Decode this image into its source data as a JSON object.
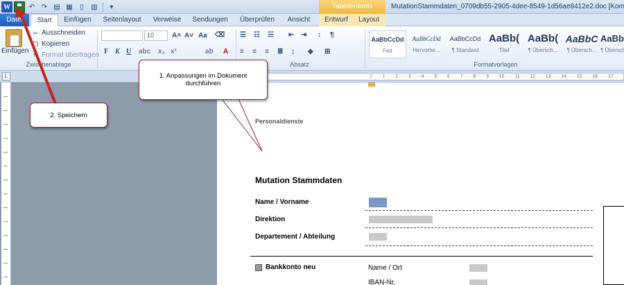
{
  "window": {
    "app_logo": "W",
    "document_title": "MutationStammdaten_0709db55-2905-4dee-8549-1d56ae8412e2.doc [Kompatibilitätsmodus]",
    "context_group": "Tabellentools"
  },
  "tabs": [
    "Datei",
    "Start",
    "Einfügen",
    "Seitenlayout",
    "Verweise",
    "Sendungen",
    "Überprüfen",
    "Ansicht",
    "Entwurf",
    "Layout"
  ],
  "ribbon": {
    "clipboard": {
      "paste": "Einfügen",
      "cut": "Ausschneiden",
      "copy": "Kopieren",
      "format_painter": "Format übertragen",
      "label": "Zwischenablage"
    },
    "font": {
      "size": "10",
      "grow": "A˄",
      "shrink": "A˅",
      "case": "Aa",
      "bold": "F",
      "italic": "K",
      "underline": "U"
    },
    "paragraph_label": "Absatz",
    "styles_label": "Formatvorlagen",
    "styles": [
      {
        "sample": "AaBbCcDd",
        "name": "Fett"
      },
      {
        "sample": "AaBbCcDd",
        "name": "Hervorhe..."
      },
      {
        "sample": "AaBbCcDd",
        "name": "¶ Standard"
      },
      {
        "sample": "AaBb(",
        "name": "Titel"
      },
      {
        "sample": "AaBb(",
        "name": "¶ Übersch..."
      },
      {
        "sample": "AaBbC",
        "name": "¶ Übersch..."
      },
      {
        "sample": "AaBb",
        "name": "¶ Übersch..."
      }
    ]
  },
  "ruler": {
    "corner": "L",
    "marks": "1 · · · 1 · · · 2 · · · 3 · · · 4 · · · 5 · · · 6 · · · 7 · · · 8 · · · 9 · · · 10 · · · 11 · · · 12 · · · 13 · · · 14 · · · 15 · · · 16 · · · 17 · · · 18"
  },
  "document": {
    "header": "Personaldienste",
    "title": "Mutation Stammdaten",
    "fields": [
      "Name / Vorname",
      "Direktion",
      "Departement  / Abteilung"
    ],
    "bank_section": "Bankkonto neu",
    "bank_fields": [
      "Name / Ort",
      "IBAN-Nr."
    ]
  },
  "callouts": {
    "step1": "1. Anpassungen im Dokument durchführen",
    "step2": "2. Speichern"
  },
  "colors": {
    "file_tab": "#2a6fcb",
    "context_tab": "#f4c24a",
    "callout_border": "#9e2323",
    "arrow": "#c0281f",
    "save_icon": "#1a7f2e"
  }
}
